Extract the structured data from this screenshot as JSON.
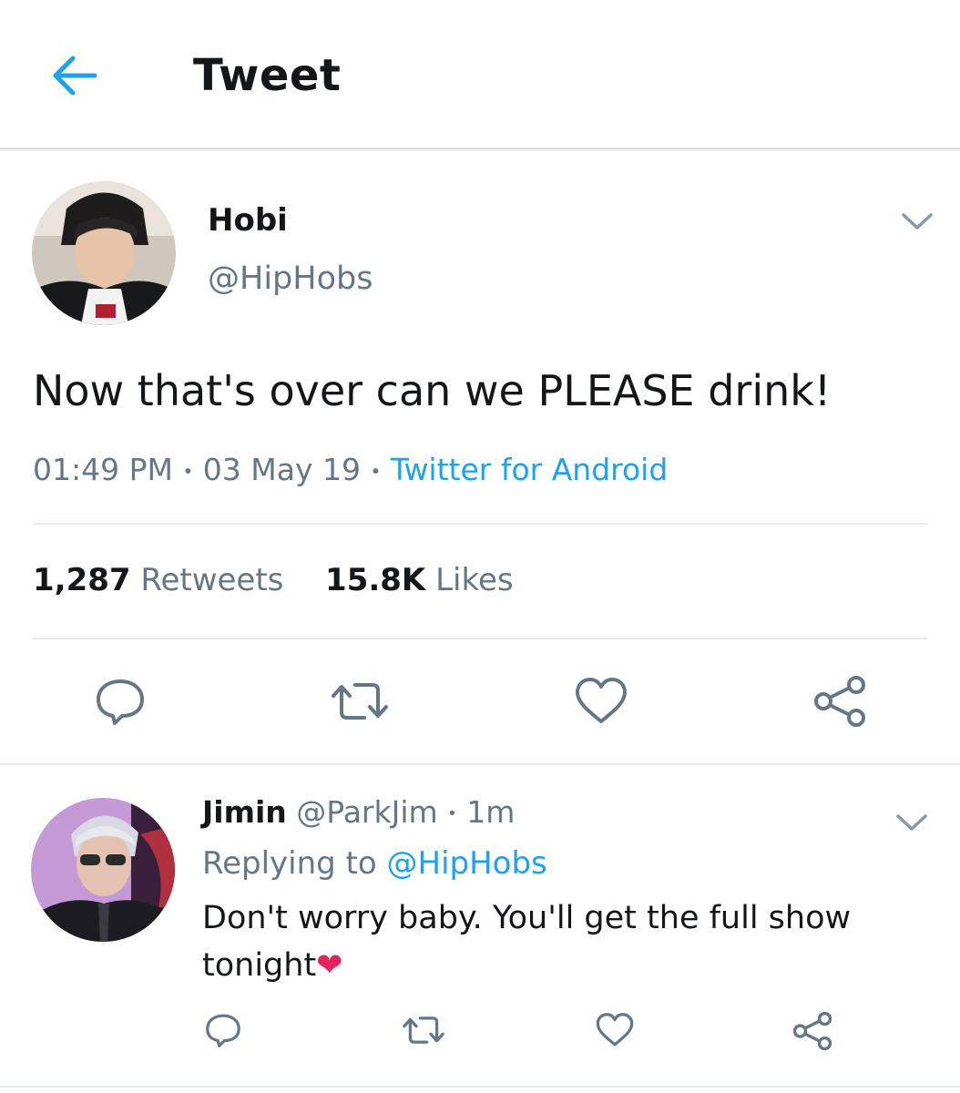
{
  "header": {
    "title": "Tweet",
    "back_icon": "arrow-left-icon",
    "accent": "#1da1f2"
  },
  "tweet": {
    "author_name": "Hobi",
    "author_handle": "@HipHobs",
    "text": "Now that's over can we PLEASE drink!",
    "time": "01:49 PM",
    "separator": "•",
    "date": "03 May 19",
    "source": "Twitter for Android",
    "retweets_count": "1,287",
    "retweets_label": "Retweets",
    "likes_count": "15.8K",
    "likes_label": "Likes",
    "actions": [
      "reply-icon",
      "retweet-icon",
      "like-icon",
      "share-icon"
    ]
  },
  "reply": {
    "author_name": "Jimin",
    "author_handle": "@ParkJim",
    "separator": "•",
    "time": "1m",
    "replying_prefix": "Replying to",
    "replying_handle": "@HipHobs",
    "text": "Don't worry baby. You'll get the full show tonight",
    "emoji": "❤",
    "actions": [
      "reply-icon",
      "retweet-icon",
      "like-icon",
      "share-icon"
    ]
  },
  "colors": {
    "text": "#14171a",
    "secondary": "#657786",
    "link": "#1da1f2",
    "divider": "#e6ecf0",
    "heart": "#e0245e"
  }
}
